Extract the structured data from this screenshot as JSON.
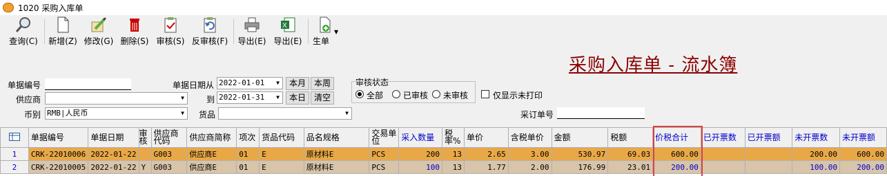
{
  "window": {
    "title": "1020 采购入库单"
  },
  "toolbar": [
    {
      "label": "查询(C)",
      "icon": "magnifier-icon"
    },
    {
      "label": "新增(Z)",
      "icon": "new-document-icon"
    },
    {
      "label": "修改(G)",
      "icon": "edit-icon"
    },
    {
      "label": "删除(S)",
      "icon": "trash-icon"
    },
    {
      "label": "审核(S)",
      "icon": "approve-icon"
    },
    {
      "label": "反审核(F)",
      "icon": "unapprove-icon"
    },
    {
      "label": "导出(E)",
      "icon": "printer-icon"
    },
    {
      "label": "导出(E)",
      "icon": "excel-icon"
    },
    {
      "label": "生单",
      "icon": "generate-doc-icon"
    }
  ],
  "heading": "采购入库单 - 流水簿",
  "filters": {
    "doc_no_label": "单据编号",
    "doc_no_value": "",
    "supplier_label": "供应商",
    "supplier_value": "",
    "currency_label": "币别",
    "currency_value": "RMB|人民币",
    "date_from_label": "单据日期从",
    "date_from_value": "2022-01-01",
    "date_to_label": "到",
    "date_to_value": "2022-01-31",
    "this_month": "本月",
    "this_week": "本周",
    "today": "本日",
    "clear": "清空",
    "goods_label": "货品",
    "goods_value": "",
    "audit_label": "审核状态",
    "audit_all": "全部",
    "audit_done": "已审核",
    "audit_not": "未审核",
    "unprinted_only": "仅显示未打印",
    "po_no_label": "采订单号",
    "po_no_value": ""
  },
  "table": {
    "columns": [
      "单据编号",
      "单据日期",
      "审核",
      "供应商代码",
      "供应商简称",
      "项次",
      "货品代码",
      "品名规格",
      "交易单位",
      "采入数量",
      "税率%",
      "单价",
      "含税单价",
      "金额",
      "税额",
      "价税合计",
      "已开票数",
      "已开票额",
      "未开票数",
      "未开票额"
    ],
    "rows": [
      {
        "n": "1",
        "doc": "CRK-22010006",
        "date": "2022-01-22",
        "audit": "",
        "scode": "G003",
        "sname": "供应商E",
        "item": "01",
        "gcode": "E",
        "gname": "原材料E",
        "unit": "PCS",
        "qty": "200",
        "tax": "13",
        "price": "2.65",
        "tprice": "3.00",
        "amt": "530.97",
        "taxamt": "69.03",
        "total": "600.00",
        "invq": "",
        "inva": "",
        "uninvq": "200.00",
        "uninva": "600.00"
      },
      {
        "n": "2",
        "doc": "CRK-22010005",
        "date": "2022-01-22",
        "audit": "Y",
        "scode": "G003",
        "sname": "供应商E",
        "item": "01",
        "gcode": "E",
        "gname": "原材料E",
        "unit": "PCS",
        "qty": "100",
        "tax": "13",
        "price": "1.77",
        "tprice": "2.00",
        "amt": "176.99",
        "taxamt": "23.01",
        "total": "200.00",
        "invq": "",
        "inva": "",
        "uninvq": "100.00",
        "uninva": "200.00"
      }
    ]
  },
  "colors": {
    "heading": "#8b0000",
    "row_selected": "#e8a848",
    "row_other": "#d8c4a8",
    "blue_text": "#0000cc",
    "highlight_box": "#e04040"
  }
}
